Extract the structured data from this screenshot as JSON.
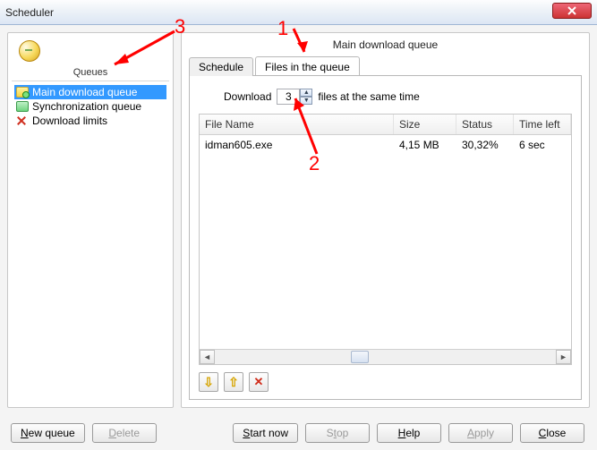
{
  "window": {
    "title": "Scheduler"
  },
  "sidebar": {
    "header": "Queues",
    "items": [
      {
        "label": "Main download queue"
      },
      {
        "label": "Synchronization queue"
      },
      {
        "label": "Download limits"
      }
    ]
  },
  "main": {
    "queue_title": "Main download queue",
    "tabs": [
      {
        "label": "Schedule"
      },
      {
        "label": "Files in the queue"
      }
    ],
    "download_prefix": "Download",
    "download_count": "3",
    "download_suffix": "files at the same time",
    "grid": {
      "columns": {
        "file_name": "File Name",
        "size": "Size",
        "status": "Status",
        "time_left": "Time left"
      },
      "rows": [
        {
          "file_name": "idman605.exe",
          "size": "4,15  MB",
          "status": "30,32%",
          "time_left": "6 sec"
        }
      ]
    }
  },
  "buttons": {
    "new_queue": "New queue",
    "delete": "Delete",
    "start_now": "Start now",
    "stop": "Stop",
    "help": "Help",
    "apply": "Apply",
    "close": "Close"
  },
  "annotations": {
    "n1": "1",
    "n2": "2",
    "n3": "3"
  }
}
